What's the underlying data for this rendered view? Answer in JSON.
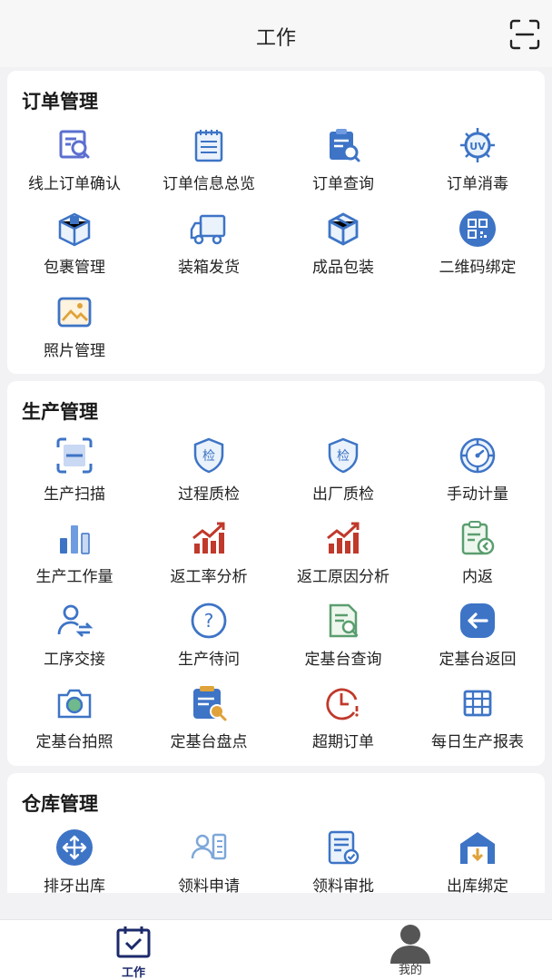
{
  "header": {
    "title": "工作",
    "scan_icon": "scan-icon"
  },
  "colors": {
    "primary_blue": "#3d74c6",
    "accent_red": "#c0392b",
    "tab_active": "#1c2a6b"
  },
  "sections": [
    {
      "title": "订单管理",
      "items": [
        {
          "label": "线上订单确认",
          "icon": "order-search-icon"
        },
        {
          "label": "订单信息总览",
          "icon": "notepad-icon"
        },
        {
          "label": "订单查询",
          "icon": "clipboard-search-icon"
        },
        {
          "label": "订单消毒",
          "icon": "uv-icon"
        },
        {
          "label": "包裹管理",
          "icon": "package-icon"
        },
        {
          "label": "装箱发货",
          "icon": "truck-icon"
        },
        {
          "label": "成品包装",
          "icon": "box-icon"
        },
        {
          "label": "二维码绑定",
          "icon": "qr-code-icon"
        },
        {
          "label": "照片管理",
          "icon": "photo-icon"
        }
      ]
    },
    {
      "title": "生产管理",
      "items": [
        {
          "label": "生产扫描",
          "icon": "scan-frame-icon"
        },
        {
          "label": "过程质检",
          "icon": "shield-check-icon"
        },
        {
          "label": "出厂质检",
          "icon": "shield-check-icon"
        },
        {
          "label": "手动计量",
          "icon": "dial-icon"
        },
        {
          "label": "生产工作量",
          "icon": "bar-chart-icon"
        },
        {
          "label": "返工率分析",
          "icon": "trend-chart-icon"
        },
        {
          "label": "返工原因分析",
          "icon": "trend-chart-icon"
        },
        {
          "label": "内返",
          "icon": "clipboard-return-icon"
        },
        {
          "label": "工序交接",
          "icon": "user-transfer-icon"
        },
        {
          "label": "生产待问",
          "icon": "question-icon"
        },
        {
          "label": "定基台查询",
          "icon": "document-search-icon"
        },
        {
          "label": "定基台返回",
          "icon": "arrow-left-icon"
        },
        {
          "label": "定基台拍照",
          "icon": "camera-icon"
        },
        {
          "label": "定基台盘点",
          "icon": "inventory-icon"
        },
        {
          "label": "超期订单",
          "icon": "clock-alert-icon"
        },
        {
          "label": "每日生产报表",
          "icon": "table-icon"
        }
      ]
    },
    {
      "title": "仓库管理",
      "items": [
        {
          "label": "排牙出库",
          "icon": "move-icon"
        },
        {
          "label": "领料申请",
          "icon": "material-request-icon"
        },
        {
          "label": "领料审批",
          "icon": "approval-icon"
        },
        {
          "label": "出库绑定",
          "icon": "warehouse-icon"
        }
      ]
    }
  ],
  "tabbar": {
    "tabs": [
      {
        "label": "工作",
        "icon": "work-calendar-icon",
        "active": true
      },
      {
        "label": "我的",
        "icon": "user-avatar-icon",
        "active": false
      }
    ]
  }
}
